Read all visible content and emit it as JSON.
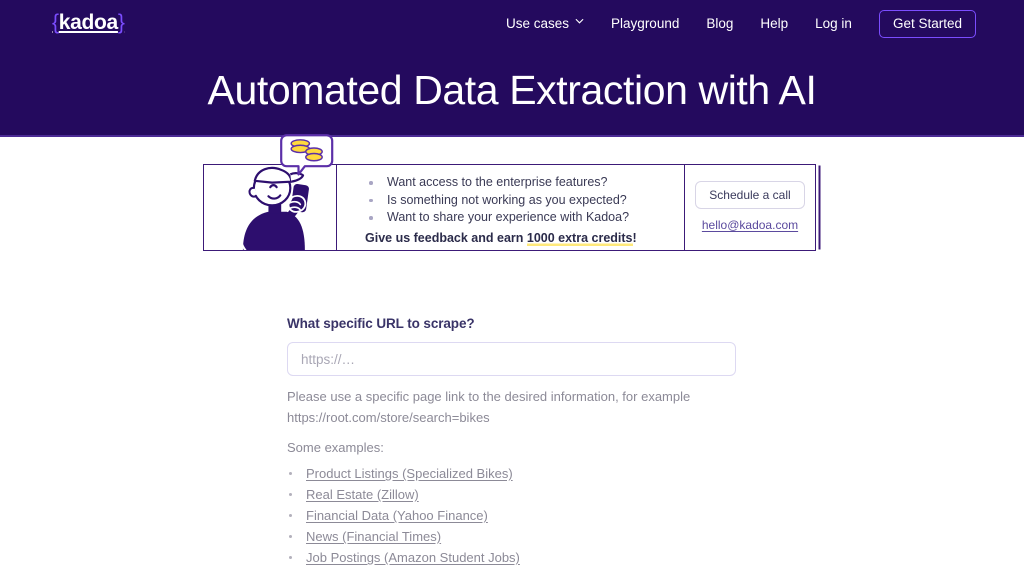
{
  "header": {
    "logo": {
      "open_brace": "{",
      "name": "kadoa",
      "close_brace": "}"
    },
    "nav": [
      {
        "label": "Use cases",
        "has_chevron": true
      },
      {
        "label": "Playground",
        "has_chevron": false
      },
      {
        "label": "Blog",
        "has_chevron": false
      },
      {
        "label": "Help",
        "has_chevron": false
      },
      {
        "label": "Log in",
        "has_chevron": false
      }
    ],
    "cta_label": "Get Started",
    "title": "Automated Data Extraction with AI",
    "background_color": "#240a5e",
    "accent_color": "#7b4dff"
  },
  "banner": {
    "illustration_alt": "person-with-phone-illustration",
    "bullets": [
      "Want access to the enterprise features?",
      "Is something not working as you expected?",
      "Want to share your experience with Kadoa?"
    ],
    "feedback_prefix": "Give us feedback and earn ",
    "feedback_highlight": "1000 extra credits",
    "feedback_suffix": "!",
    "schedule_label": "Schedule a call",
    "email": "hello@kadoa.com",
    "border_color": "#3c1a78",
    "highlight_color": "#ffe97a"
  },
  "form": {
    "label": "What specific URL to scrape?",
    "input_value": "",
    "placeholder": "https://…",
    "helper_text": "Please use a specific page link to the desired information, for example https://root.com/store/search=bikes",
    "examples_title": "Some examples:",
    "examples": [
      "Product Listings (Specialized Bikes)",
      "Real Estate (Zillow)",
      "Financial Data (Yahoo Finance)",
      "News (Financial Times)",
      "Job Postings (Amazon Student Jobs)"
    ]
  }
}
